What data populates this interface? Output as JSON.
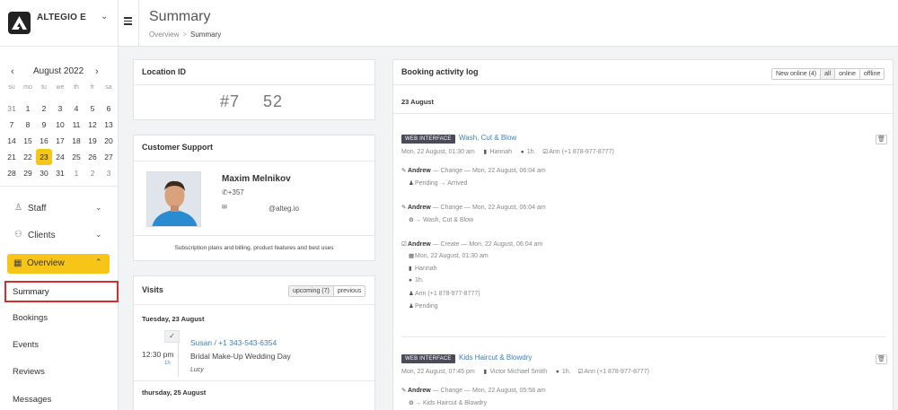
{
  "brand": {
    "name": "ALTEGIO E"
  },
  "calendar": {
    "month": "August 2022",
    "prev": "‹",
    "next": "›",
    "weekdays": [
      "su",
      "mo",
      "tu",
      "we",
      "th",
      "fr",
      "sa"
    ],
    "days": [
      [
        "31",
        "1",
        "2",
        "3",
        "4",
        "5",
        "6"
      ],
      [
        "7",
        "8",
        "9",
        "10",
        "11",
        "12",
        "13"
      ],
      [
        "14",
        "15",
        "16",
        "17",
        "18",
        "19",
        "20"
      ],
      [
        "21",
        "22",
        "23",
        "24",
        "25",
        "26",
        "27"
      ],
      [
        "28",
        "29",
        "30",
        "31",
        "1",
        "2",
        "3"
      ]
    ],
    "selected": "23"
  },
  "nav": {
    "staff": "Staff",
    "clients": "Clients",
    "overview": "Overview",
    "summary": "Summary",
    "bookings": "Bookings",
    "events": "Events",
    "reviews": "Reviews",
    "messages": "Messages"
  },
  "header": {
    "title": "Summary",
    "breadcrumb_parent": "Overview",
    "breadcrumb_sep": ">",
    "breadcrumb_current": "Summary"
  },
  "location": {
    "title": "Location ID",
    "id_prefix": "#7",
    "id_suffix": "52"
  },
  "support": {
    "title": "Customer Support",
    "name": "Maxim Melnikov",
    "phone": "+357",
    "email": "@alteg.io",
    "footer": "Subscription plans and billing, product features and best uses"
  },
  "visits": {
    "title": "Visits",
    "filter_upcoming": "upcoming (7)",
    "filter_previous": "previous",
    "day1": "Tuesday, 23 August",
    "day2": "thursday, 25 August",
    "visit": {
      "time": "12:30 pm",
      "duration": "1h",
      "client": "Susan / +1 343-543-6354",
      "service": "Bridal Make-Up Wedding Day",
      "staff": "Lucy"
    }
  },
  "log": {
    "title": "Booking activity log",
    "filters": [
      "New online (4)",
      "all",
      "online",
      "offline"
    ],
    "date": "23 August",
    "entry1": {
      "badge": "WEB INTERFACE",
      "service": "Wash, Cut & Blow",
      "datetime": "Mon, 22 August, 01:30 am",
      "staff": "Hannah",
      "duration": "1h.",
      "client": "Ann (+1 878-977-8777)",
      "change1_author": "Andrew",
      "change1_text": " — Change — Mon, 22 August, 06:04 am",
      "change1_detail": "Pending → Arrived",
      "change2_author": "Andrew",
      "change2_text": " — Change — Mon, 22 August, 06:04 am",
      "change2_detail": "→ Wash, Cut & Blow",
      "create_author": "Andrew",
      "create_text": " — Create — Mon, 22 August, 06:04 am",
      "create_date": "Mon, 22 August, 01:30 am",
      "create_staff": "Hannah",
      "create_duration": "1h.",
      "create_client": "Ann (+1 878-977-8777)",
      "create_status": "Pending"
    },
    "entry2": {
      "badge": "WEB INTERFACE",
      "service": "Kids Haircut & Blowdry",
      "datetime": "Mon, 22 August, 07:45 pm",
      "staff": "Victor Michael Smith",
      "duration": "1h.",
      "client": "Ann (+1 878-977-8777)",
      "change1_author": "Andrew",
      "change1_text": " — Change — Mon, 22 August, 05:58 am",
      "change1_detail": "→ Kids Haircut & Blowdry"
    }
  },
  "colors": {
    "accent": "#f7c518",
    "link": "#3a7fc0",
    "badge": "#4a4a58",
    "highlight": "#d32f2f"
  }
}
